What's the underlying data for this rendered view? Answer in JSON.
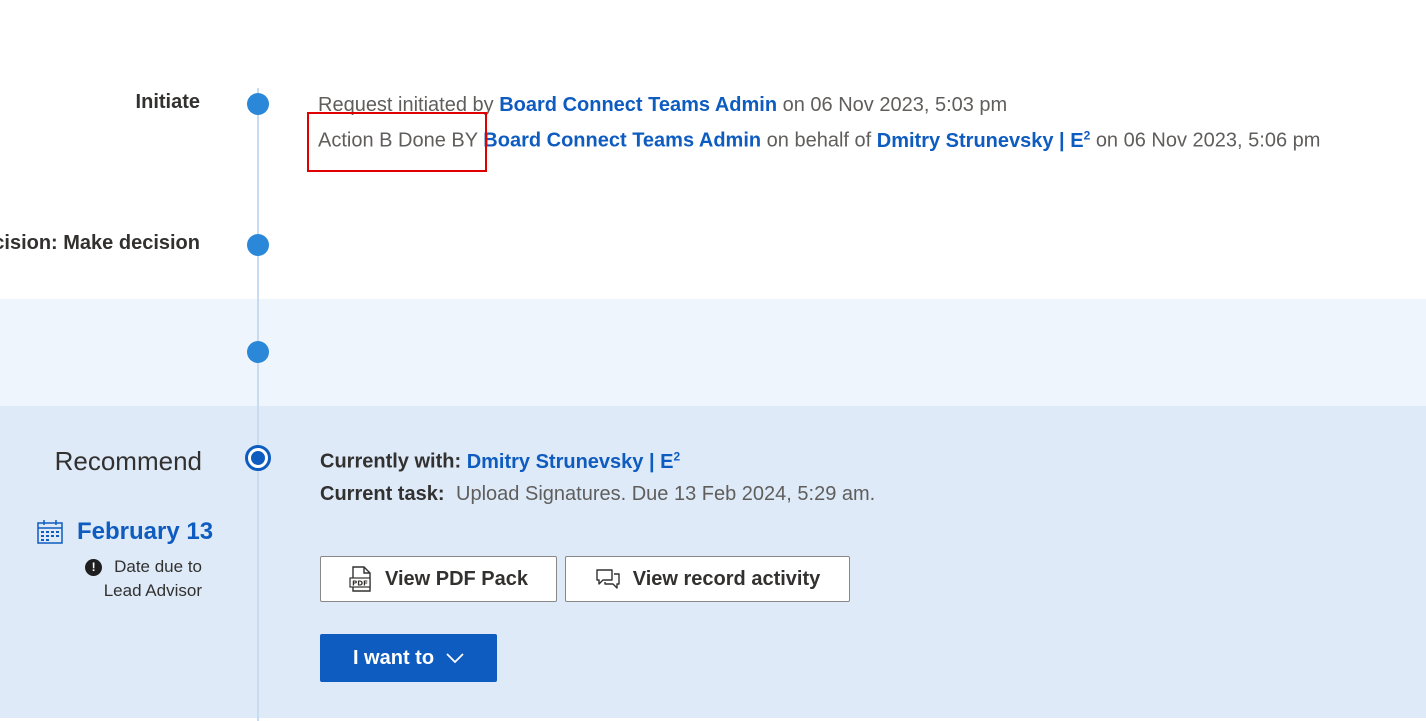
{
  "timeline": {
    "stages": [
      {
        "label": "Initiate"
      },
      {
        "label": "cision: Make decision"
      },
      {
        "label": ""
      },
      {
        "label": "Recommend"
      }
    ]
  },
  "initiate": {
    "line1": {
      "prefix": "Request initiated by",
      "actor": "Board Connect Teams Admin",
      "suffix": "on 06 Nov 2023, 5:03 pm"
    },
    "line2": {
      "prefix": "Action B Done BY",
      "actor": "Board Connect Teams Admin",
      "middle": "on behalf of",
      "behalf": "Dmitry Strunevsky | E",
      "behalf_sup": "2",
      "suffix": "on 06 Nov 2023, 5:06 pm"
    }
  },
  "current": {
    "with_label": "Currently with:",
    "with_value": "Dmitry Strunevsky | E",
    "with_sup": "2",
    "task_label": "Current task:",
    "task_value": "Upload Signatures. Due 13 Feb 2024, 5:29 am."
  },
  "due": {
    "date": "February 13",
    "note_line1": "Date due to",
    "note_line2": "Lead Advisor",
    "icon": "calendar-icon",
    "warn_icon": "exclamation-circle-icon"
  },
  "buttons": {
    "pdf_pack": "View PDF Pack",
    "record_activity": "View record activity",
    "i_want_to": "I want to"
  },
  "colors": {
    "accent": "#0f5cc0",
    "timeline_dot": "#2b88d8",
    "highlight": "#e00000",
    "current_band": "#deeaf8"
  }
}
